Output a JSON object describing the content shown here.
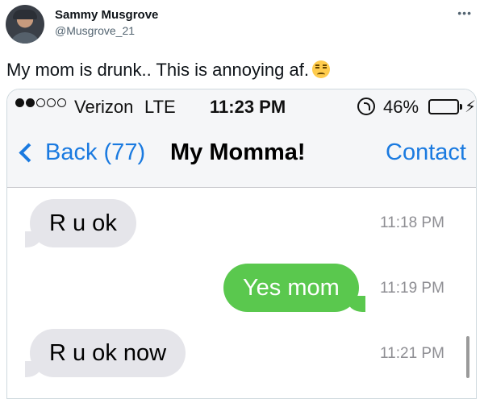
{
  "tweet": {
    "display_name": "Sammy Musgrove",
    "handle": "@Musgrove_21",
    "more_icon": "more-horizontal-icon",
    "text": "My mom is drunk.. This is annoying af.",
    "emoji": "unamused-face-emoji"
  },
  "phone": {
    "status_bar": {
      "signal_dots_filled": 2,
      "signal_dots_total": 5,
      "carrier": "Verizon",
      "network": "LTE",
      "time": "11:23 PM",
      "battery_percent_label": "46%",
      "battery_level": 0.46,
      "charging_glyph": "⚡"
    },
    "nav": {
      "back_label": "Back (77)",
      "title": "My Momma!",
      "contact_label": "Contact"
    },
    "messages": [
      {
        "direction": "incoming",
        "text": "R u ok",
        "time": "11:18 PM"
      },
      {
        "direction": "outgoing",
        "text": "Yes mom",
        "time": "11:19 PM"
      },
      {
        "direction": "incoming",
        "text": "R u ok now",
        "time": "11:21 PM"
      }
    ],
    "colors": {
      "accent_blue": "#1a7ae0",
      "outgoing_bubble": "#5ac84e",
      "incoming_bubble": "#e5e5ea",
      "battery_green": "#4cd964"
    }
  }
}
